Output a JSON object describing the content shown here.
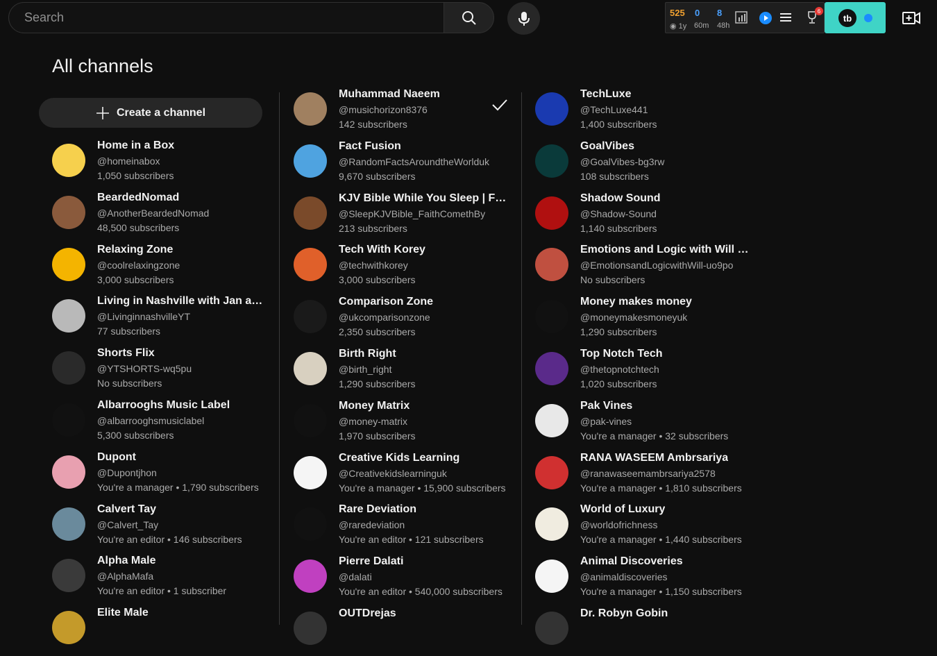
{
  "header": {
    "search_placeholder": "Search",
    "stats": {
      "a": "525",
      "b": "0",
      "c": "8",
      "a_sub": "1y",
      "b_sub": "60m",
      "c_sub": "48h"
    },
    "badge_count": "6",
    "tb_logo": "tb"
  },
  "page": {
    "title": "All channels",
    "create_channel_label": "Create a channel"
  },
  "columns": [
    [
      {
        "name": "Home in a Box",
        "handle": "@homeinabox",
        "subs": "1,050 subscribers",
        "color": "#f6d04d",
        "icon": "house-avatar"
      },
      {
        "name": "BeardedNomad",
        "handle": "@AnotherBeardedNomad",
        "subs": "48,500 subscribers",
        "color": "#8a5a3c",
        "icon": "person-avatar"
      },
      {
        "name": "Relaxing Zone",
        "handle": "@coolrelaxingzone",
        "subs": "3,000 subscribers",
        "color": "#f4b400",
        "icon": "palm-avatar"
      },
      {
        "name": "Living in Nashville with Jan and ...",
        "handle": "@LivinginnashvilleYT",
        "subs": "77 subscribers",
        "color": "#b9b9b9",
        "icon": "couple-avatar"
      },
      {
        "name": "Shorts Flix",
        "handle": "@YTSHORTS-wq5pu",
        "subs": "No subscribers",
        "color": "#2a2a2a",
        "icon": "dark-avatar"
      },
      {
        "name": "Albarrooghs Music Label",
        "handle": "@albarrooghsmusiclabel",
        "subs": "5,300 subscribers",
        "color": "#111111",
        "icon": "corsi-avatar"
      },
      {
        "name": "Dupont",
        "handle": "@Dupontjhon",
        "subs": "You're a manager • 1,790 subscribers",
        "color": "#e8a0b0",
        "icon": "cartoon-avatar"
      },
      {
        "name": "Calvert Tay",
        "handle": "@Calvert_Tay",
        "subs": "You're an editor • 146 subscribers",
        "color": "#6a8a9c",
        "icon": "person-avatar"
      },
      {
        "name": "Alpha Male",
        "handle": "@AlphaMafa",
        "subs": "You're an editor • 1 subscriber",
        "color": "#3a3a3a",
        "icon": "person-avatar"
      },
      {
        "name": "Elite Male",
        "handle": "",
        "subs": "",
        "color": "#c49a2a",
        "icon": "person-avatar"
      }
    ],
    [
      {
        "name": "Muhammad Naeem",
        "handle": "@musichorizon8376",
        "subs": "142 subscribers",
        "color": "#a08060",
        "icon": "knight-avatar",
        "checked": true
      },
      {
        "name": "Fact Fusion",
        "handle": "@RandomFactsAroundtheWorlduk",
        "subs": "9,670 subscribers",
        "color": "#4fa3e0",
        "icon": "fact-avatar"
      },
      {
        "name": "KJV Bible While You Sleep | Fait...",
        "handle": "@SleepKJVBible_FaithComethBy",
        "subs": "213 subscribers",
        "color": "#7a4a2a",
        "icon": "bible-avatar"
      },
      {
        "name": "Tech With Korey",
        "handle": "@techwithkorey",
        "subs": "3,000 subscribers",
        "color": "#e0602a",
        "icon": "tech-avatar"
      },
      {
        "name": "Comparison Zone",
        "handle": "@ukcomparisonzone",
        "subs": "2,350 subscribers",
        "color": "#1a1a1a",
        "icon": "cz-avatar"
      },
      {
        "name": "Birth Right",
        "handle": "@birth_right",
        "subs": "1,290 subscribers",
        "color": "#d8d0c0",
        "icon": "statue-avatar"
      },
      {
        "name": "Money Matrix",
        "handle": "@money-matrix",
        "subs": "1,970 subscribers",
        "color": "#111111",
        "icon": "mm-avatar"
      },
      {
        "name": "Creative Kids Learning",
        "handle": "@Creativekidslearninguk",
        "subs": "You're a manager • 15,900 subscribers",
        "color": "#f5f5f5",
        "icon": "kids-avatar"
      },
      {
        "name": "Rare Deviation",
        "handle": "@raredeviation",
        "subs": "You're an editor • 121 subscribers",
        "color": "#111111",
        "icon": "rare-avatar"
      },
      {
        "name": "Pierre Dalati",
        "handle": "@dalati",
        "subs": "You're an editor • 540,000 subscribers",
        "color": "#c040c0",
        "icon": "person-avatar"
      },
      {
        "name": "OUTDrejas",
        "handle": "",
        "subs": "",
        "color": "#333333",
        "icon": "person-avatar"
      }
    ],
    [
      {
        "name": "TechLuxe",
        "handle": "@TechLuxe441",
        "subs": "1,400 subscribers",
        "color": "#1a3ab0",
        "icon": "techluxe-avatar"
      },
      {
        "name": "GoalVibes",
        "handle": "@GoalVibes-bg3rw",
        "subs": "108 subscribers",
        "color": "#0a3a3a",
        "icon": "goal-avatar"
      },
      {
        "name": "Shadow Sound",
        "handle": "@Shadow-Sound",
        "subs": "1,140 subscribers",
        "color": "#b01010",
        "icon": "shadow-avatar"
      },
      {
        "name": "Emotions and Logic with Will & I...",
        "handle": "@EmotionsandLogicwithWill-uo9po",
        "subs": "No subscribers",
        "color": "#c05040",
        "icon": "couple-avatar"
      },
      {
        "name": "Money makes money",
        "handle": "@moneymakesmoneyuk",
        "subs": "1,290 subscribers",
        "color": "#111111",
        "icon": "money-avatar"
      },
      {
        "name": "Top Notch Tech",
        "handle": "@thetopnotchtech",
        "subs": "1,020 subscribers",
        "color": "#5a2a8a",
        "icon": "tnt-avatar"
      },
      {
        "name": "Pak Vines",
        "handle": "@pak-vines",
        "subs": "You're a manager • 32 subscribers",
        "color": "#e8e8e8",
        "icon": "vines-avatar"
      },
      {
        "name": "RANA WASEEM Ambrsariya",
        "handle": "@ranawaseemambrsariya2578",
        "subs": "You're a manager • 1,810 subscribers",
        "color": "#d03030",
        "icon": "person-avatar"
      },
      {
        "name": "World of Luxury",
        "handle": "@worldofrichness",
        "subs": "You're a manager • 1,440 subscribers",
        "color": "#f0ece0",
        "icon": "luxury-avatar"
      },
      {
        "name": "Animal Discoveries",
        "handle": "@animaldiscoveries",
        "subs": "You're a manager • 1,150 subscribers",
        "color": "#f5f5f5",
        "icon": "paw-avatar"
      },
      {
        "name": "Dr. Robyn Gobin",
        "handle": "",
        "subs": "",
        "color": "#333333",
        "icon": "person-avatar"
      }
    ]
  ]
}
